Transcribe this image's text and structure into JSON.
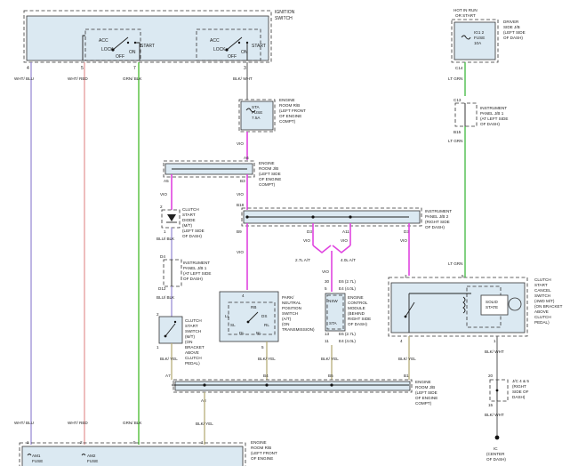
{
  "components": {
    "ignition_switch": "IGNITION SWITCH",
    "hot_in_run": "HOT IN RUN OR START",
    "driver_jb": "DRIVER SIDE J/B (LEFT SIDE OF DASH)",
    "ig1_fuse": "IG1 2 FUSE 10A",
    "engine_rb_sta": "ENGINE ROOM R/B (LEFT FRONT OF ENGINE COMPT)",
    "sta_fuse": "STA FUSE 7.5A",
    "engine_jb_a": "ENGINE ROOM J/B (LEFT SIDE OF ENGINE COMPT)",
    "inst_panel_jb1_top": "INSTRUMENT PANEL J/B 1 (AT LEFT SIDE OF DASH)",
    "inst_panel_jb2": "INSTRUMENT PANEL J/B 2 (RIGHT SIDE OF DASH)",
    "clutch_diode": "CLUTCH START DIODE (M/T) (LEFT SIDE OF DASH)",
    "inst_panel_jb1_mid": "INSTRUMENT PANEL J/B 1 (AT LEFT SIDE OF DASH)",
    "clutch_switch": "CLUTCH START SWITCH (M/T) (ON BRACKET ABOVE CLUTCH PEDAL)",
    "park_neutral": "PARK/ NEUTRAL POSITION SWITCH (A/T) (ON TRANSMISSION)",
    "ecm": "ENGINE CONTROL MODULE (BEHIND RIGHT SIDE OF DASH)",
    "cancel_switch": "CLUTCH START CANCEL SWITCH (4WD M/T) (ON BRACKET ABOVE CLUTCH PEDAL)",
    "solid_state": "SOLID STATE",
    "engine_jb_b": "ENGINE ROOM J/B (LEFT SIDE OF ENGINE COMPT)",
    "jc": "J/C 4 & 5 (RIGHT SIDE OF DASH)",
    "ground": "IC (CENTER OF DASH)",
    "engine_rb_bottom": "ENGINE ROOM R/B (LEFT FRONT OF ENGINE"
  },
  "switch_positions": {
    "acc": "ACC",
    "lock": "LOCK",
    "on": "ON",
    "off": "OFF",
    "start": "START"
  },
  "pn_switch": {
    "rb": "RB",
    "ll": "LL",
    "ds": "DS",
    "sl": "SL",
    "rl": "RL",
    "dl": "DL",
    "nl": "NL"
  },
  "pins": {
    "sw4": "4",
    "sw5": "5",
    "sw7": "7",
    "sw3": "3",
    "c14": "C14",
    "c13": "C13",
    "b15": "B15",
    "a6": "A6",
    "a5": "A5",
    "b3": "B3",
    "b18": "B18",
    "b9": "B9",
    "d3a": "D3",
    "a11": "A11",
    "d3b": "D3",
    "d2_2": "2",
    "d2_1": "1",
    "d4": "D4",
    "d12": "D12",
    "cs2": "2",
    "cs1": "1",
    "pn4": "4",
    "pn5": "5",
    "e30": "30",
    "e5": "5",
    "e13": "13",
    "e11": "11",
    "cc2": "2",
    "cc5": "5",
    "cc4": "4",
    "cc1": "1",
    "a7": "A7",
    "b4": "B4",
    "b5": "B5",
    "b1": "B1",
    "a8": "A8",
    "jc20": "20",
    "jc15": "15",
    "bot_am1": "1",
    "bot_am2": "2",
    "bot_5": "5",
    "bot_1": "1"
  },
  "ecm_pins": {
    "e6_27": "E6 (2.7L)",
    "e4_40": "E4 (4.0L)",
    "e6_27b": "E6 (2.7L)",
    "e4_40b": "E4 (4.0L)",
    "nsw": "NSW",
    "sta": "STA",
    "a27": "2.7L A/T",
    "a40": "4.0L A/T"
  },
  "wire_colors": {
    "wht_blu": "WHT/ BLU",
    "wht_red": "WHT/ RED",
    "grn_blk": "GRN/ BLK",
    "blk_wht": "BLK/ WHT",
    "lt_grn_a": "LT GRN",
    "lt_grn_b": "LT GRN",
    "lt_grn_c": "LT GRN",
    "vio_1": "VIO",
    "vio_2": "VIO",
    "vio_3": "VIO",
    "vio_4": "VIO",
    "vio_5": "VIO",
    "vio_6": "VIO",
    "vio_7": "VIO",
    "vio_8": "VIO",
    "vio_9": "VIO",
    "blu_blk": "BLU/ BLK",
    "blu_blk2": "BLU/ BLK",
    "blk_yel_1": "BLK/ YEL",
    "blk_yel_2": "BLK/ YEL",
    "blk_yel_3": "BLK/ YEL",
    "blk_yel_4": "BLK/ YEL",
    "blk_yel_5": "BLK/ YEL",
    "blk_wht_2": "BLK/ WHT",
    "wht_blu_b": "WHT/ BLU",
    "wht_red_b": "WHT/ RED",
    "grn_blk_b": "GRN/ BLK",
    "blk_yel_b": "BLK/ YEL",
    "blk_wht_b": "BLK/ WHT"
  },
  "bottom_fuses": {
    "am1": "AM1 FUSE",
    "am2": "AM2 FUSE"
  }
}
